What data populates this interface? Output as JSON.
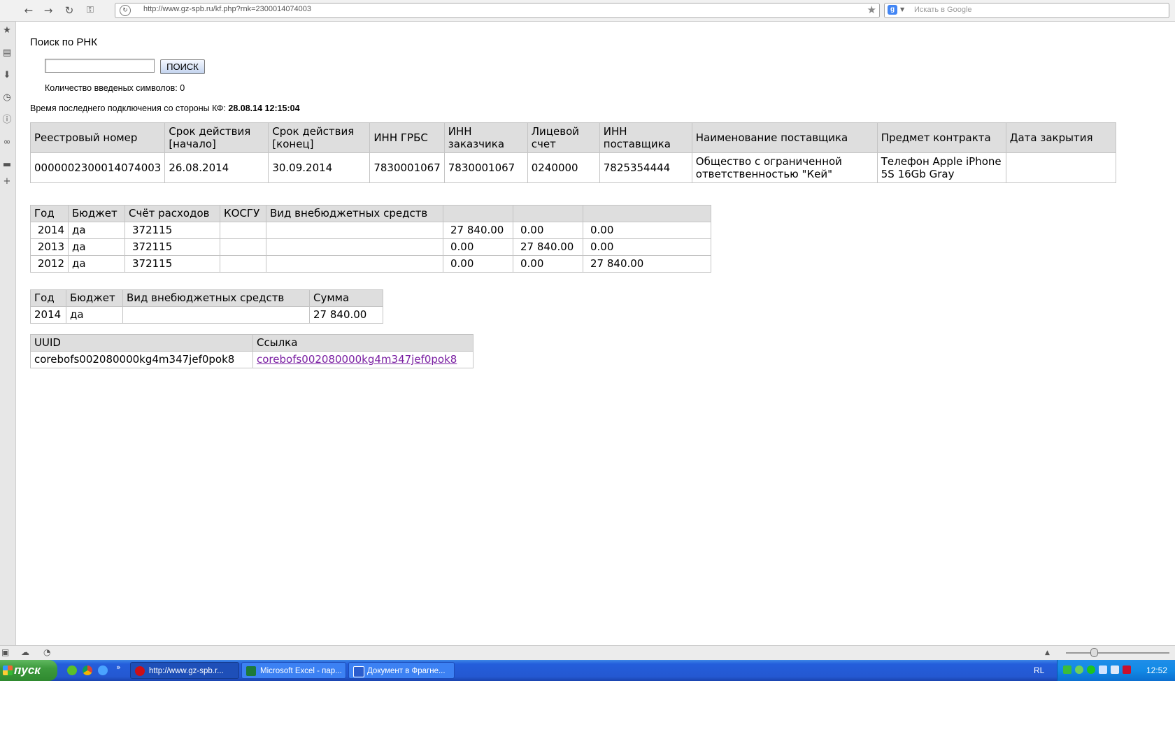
{
  "browser": {
    "url": "http://www.gz-spb.ru/kf.php?rnk=2300014074003",
    "search_placeholder": "Искать в Google"
  },
  "page": {
    "title": "Поиск по РНК",
    "search_button": "ПОИСК",
    "search_value": "",
    "char_count_label": "Количество введеных символов: 0",
    "last_connection_label": "Время последнего подключения со стороны КФ:",
    "last_connection_value": "28.08.14 12:15:04"
  },
  "main_table": {
    "headers": [
      "Реестровый номер",
      "Срок действия [начало]",
      "Срок действия [конец]",
      "ИНН ГРБС",
      "ИНН заказчика",
      "Лицевой счет",
      "ИНН поставщика",
      "Наименование поставщика",
      "Предмет контракта",
      "Дата закрытия"
    ],
    "rows": [
      [
        "0000002300014074003",
        "26.08.2014",
        "30.09.2014",
        "7830001067",
        "7830001067",
        "0240000",
        "7825354444",
        "Общество с ограниченной ответственностью \"Кей\"",
        "Телефон Apple iPhone 5S 16Gb Gray",
        ""
      ]
    ]
  },
  "years_table": {
    "headers": [
      "Год",
      "Бюджет",
      "Счёт расходов",
      "КОСГУ",
      "Вид внебюджетных средств",
      "",
      "",
      ""
    ],
    "rows": [
      [
        "2014",
        "да",
        "372115",
        "",
        "",
        "27 840.00",
        "0.00",
        "0.00"
      ],
      [
        "2013",
        "да",
        "372115",
        "",
        "",
        "0.00",
        "27 840.00",
        "0.00"
      ],
      [
        "2012",
        "да",
        "372115",
        "",
        "",
        "0.00",
        "0.00",
        "27 840.00"
      ]
    ]
  },
  "funding_table": {
    "headers": [
      "Год",
      "Бюджет",
      "Вид внебюджетных средств",
      "Сумма"
    ],
    "rows": [
      [
        "2014",
        "да",
        "",
        "27 840.00"
      ]
    ]
  },
  "uuid_table": {
    "headers": [
      "UUID",
      "Ссылка"
    ],
    "uuid": "corebofs002080000kg4m347jef0pok8",
    "link": "corebofs002080000kg4m347jef0pok8"
  },
  "taskbar": {
    "start": "пуск",
    "tasks": [
      "http://www.gz-spb.r...",
      "Microsoft Excel - пар...",
      "Документ в Фрагне..."
    ],
    "language": "RL",
    "clock": "12:52"
  }
}
